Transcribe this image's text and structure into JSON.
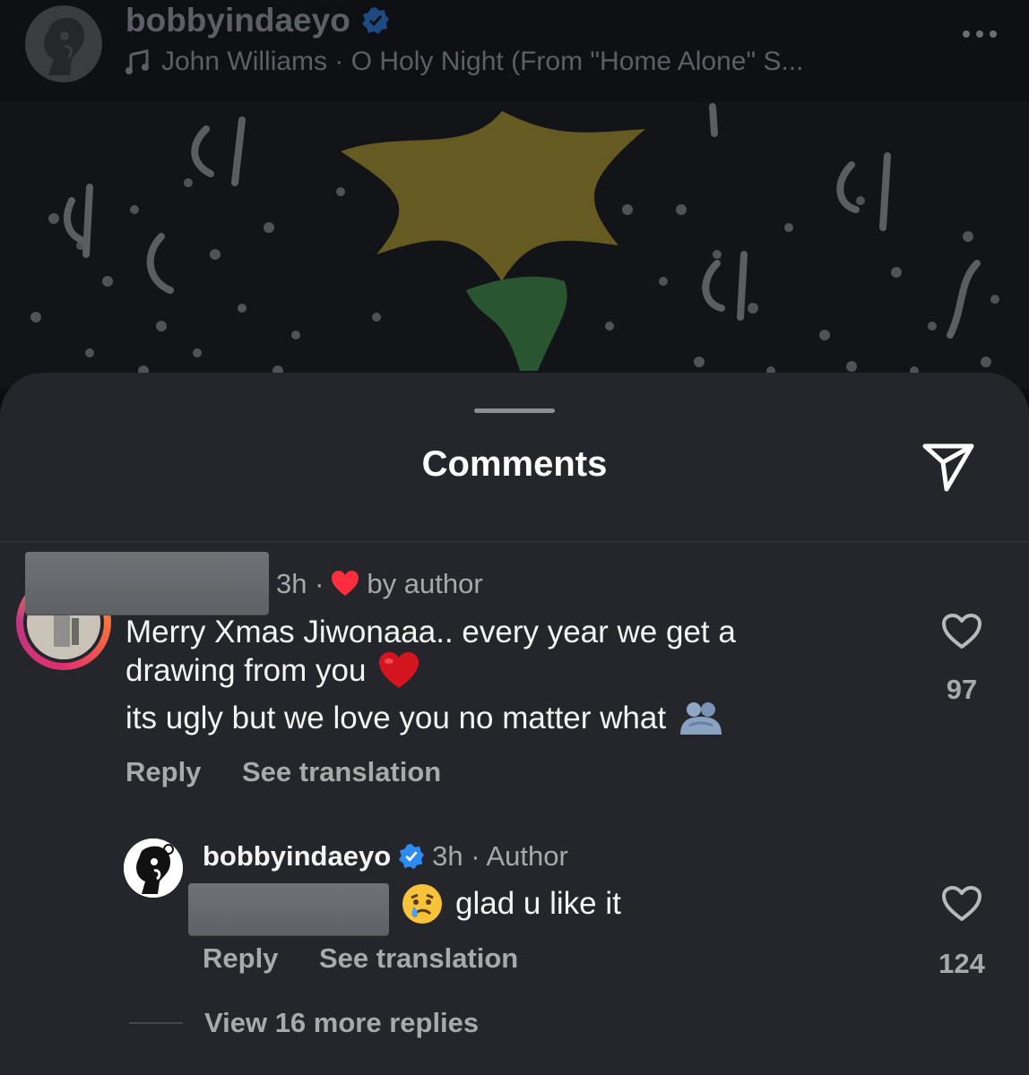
{
  "post": {
    "username": "bobbyindaeyo",
    "music_text": "John Williams · O Holy Night (From \"Home Alone\" S..."
  },
  "sheet": {
    "title": "Comments"
  },
  "comment": {
    "time": "3h ·",
    "liked_by": "by author",
    "line1": "Merry Xmas Jiwonaaa.. every year we get a",
    "line2": "drawing from you",
    "line3": "its ugly but we love you no matter what",
    "reply_label": "Reply",
    "translate_label": "See translation",
    "likes": "97"
  },
  "reply": {
    "username": "bobbyindaeyo",
    "time": "3h · Author",
    "text": "glad u like it",
    "reply_label": "Reply",
    "translate_label": "See translation",
    "likes": "124",
    "view_more": "View 16 more replies"
  },
  "colors": {
    "sheet_bg": "#25262b",
    "verified": "#2c8cf4",
    "heart": "#ff2d3d"
  }
}
